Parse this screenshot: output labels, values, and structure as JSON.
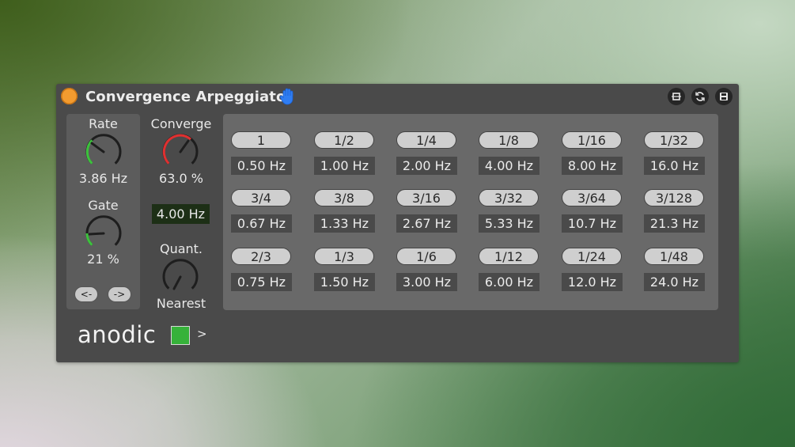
{
  "device": {
    "title": "Convergence Arpeggiator",
    "logo": "anodic",
    "more_label": ">",
    "colors": {
      "power": "#f39b2f",
      "enable": "#36b23a",
      "knob_arc_green": "#3cc23c",
      "knob_arc_red": "#e03030"
    }
  },
  "controls": {
    "rate": {
      "label": "Rate",
      "value": "3.86 Hz"
    },
    "gate": {
      "label": "Gate",
      "value": "21 %"
    },
    "prev_label": "<-",
    "next_label": "->",
    "converge": {
      "label": "Converge",
      "value": "63.0 %",
      "display": "4.00 Hz"
    },
    "quant": {
      "label": "Quant.",
      "value": "Nearest"
    }
  },
  "grid": [
    [
      {
        "division": "1",
        "hz": "0.50 Hz"
      },
      {
        "division": "1/2",
        "hz": "1.00 Hz"
      },
      {
        "division": "1/4",
        "hz": "2.00 Hz"
      },
      {
        "division": "1/8",
        "hz": "4.00 Hz"
      },
      {
        "division": "1/16",
        "hz": "8.00 Hz"
      },
      {
        "division": "1/32",
        "hz": "16.0 Hz"
      }
    ],
    [
      {
        "division": "3/4",
        "hz": "0.67 Hz"
      },
      {
        "division": "3/8",
        "hz": "1.33 Hz"
      },
      {
        "division": "3/16",
        "hz": "2.67 Hz"
      },
      {
        "division": "3/32",
        "hz": "5.33 Hz"
      },
      {
        "division": "3/64",
        "hz": "10.7 Hz"
      },
      {
        "division": "3/128",
        "hz": "21.3 Hz"
      }
    ],
    [
      {
        "division": "2/3",
        "hz": "0.75 Hz"
      },
      {
        "division": "1/3",
        "hz": "1.50 Hz"
      },
      {
        "division": "1/6",
        "hz": "3.00 Hz"
      },
      {
        "division": "1/12",
        "hz": "6.00 Hz"
      },
      {
        "division": "1/24",
        "hz": "12.0 Hz"
      },
      {
        "division": "1/48",
        "hz": "24.0 Hz"
      }
    ]
  ]
}
